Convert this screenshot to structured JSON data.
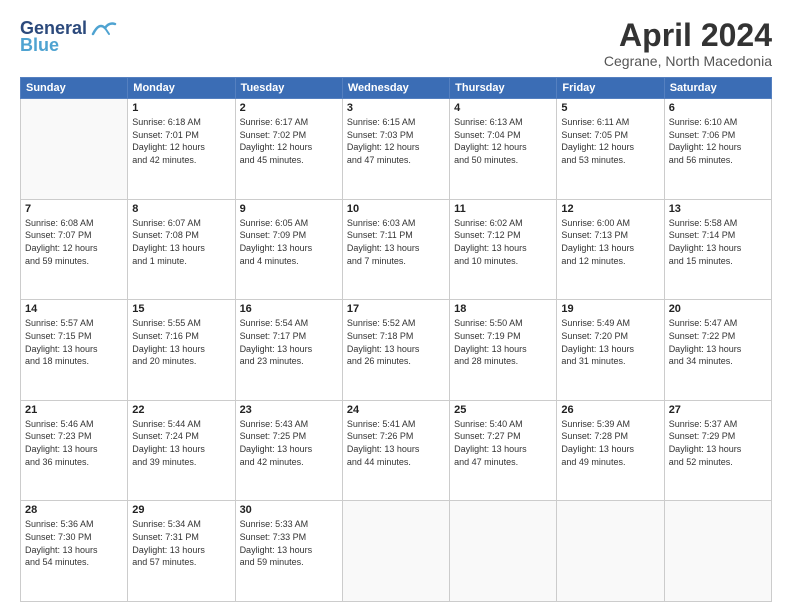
{
  "header": {
    "logo_line1": "General",
    "logo_line2": "Blue",
    "month": "April 2024",
    "location": "Cegrane, North Macedonia"
  },
  "weekdays": [
    "Sunday",
    "Monday",
    "Tuesday",
    "Wednesday",
    "Thursday",
    "Friday",
    "Saturday"
  ],
  "weeks": [
    [
      {
        "day": "",
        "sunrise": "",
        "sunset": "",
        "daylight": ""
      },
      {
        "day": "1",
        "sunrise": "Sunrise: 6:18 AM",
        "sunset": "Sunset: 7:01 PM",
        "daylight": "Daylight: 12 hours and 42 minutes."
      },
      {
        "day": "2",
        "sunrise": "Sunrise: 6:17 AM",
        "sunset": "Sunset: 7:02 PM",
        "daylight": "Daylight: 12 hours and 45 minutes."
      },
      {
        "day": "3",
        "sunrise": "Sunrise: 6:15 AM",
        "sunset": "Sunset: 7:03 PM",
        "daylight": "Daylight: 12 hours and 47 minutes."
      },
      {
        "day": "4",
        "sunrise": "Sunrise: 6:13 AM",
        "sunset": "Sunset: 7:04 PM",
        "daylight": "Daylight: 12 hours and 50 minutes."
      },
      {
        "day": "5",
        "sunrise": "Sunrise: 6:11 AM",
        "sunset": "Sunset: 7:05 PM",
        "daylight": "Daylight: 12 hours and 53 minutes."
      },
      {
        "day": "6",
        "sunrise": "Sunrise: 6:10 AM",
        "sunset": "Sunset: 7:06 PM",
        "daylight": "Daylight: 12 hours and 56 minutes."
      }
    ],
    [
      {
        "day": "7",
        "sunrise": "Sunrise: 6:08 AM",
        "sunset": "Sunset: 7:07 PM",
        "daylight": "Daylight: 12 hours and 59 minutes."
      },
      {
        "day": "8",
        "sunrise": "Sunrise: 6:07 AM",
        "sunset": "Sunset: 7:08 PM",
        "daylight": "Daylight: 13 hours and 1 minute."
      },
      {
        "day": "9",
        "sunrise": "Sunrise: 6:05 AM",
        "sunset": "Sunset: 7:09 PM",
        "daylight": "Daylight: 13 hours and 4 minutes."
      },
      {
        "day": "10",
        "sunrise": "Sunrise: 6:03 AM",
        "sunset": "Sunset: 7:11 PM",
        "daylight": "Daylight: 13 hours and 7 minutes."
      },
      {
        "day": "11",
        "sunrise": "Sunrise: 6:02 AM",
        "sunset": "Sunset: 7:12 PM",
        "daylight": "Daylight: 13 hours and 10 minutes."
      },
      {
        "day": "12",
        "sunrise": "Sunrise: 6:00 AM",
        "sunset": "Sunset: 7:13 PM",
        "daylight": "Daylight: 13 hours and 12 minutes."
      },
      {
        "day": "13",
        "sunrise": "Sunrise: 5:58 AM",
        "sunset": "Sunset: 7:14 PM",
        "daylight": "Daylight: 13 hours and 15 minutes."
      }
    ],
    [
      {
        "day": "14",
        "sunrise": "Sunrise: 5:57 AM",
        "sunset": "Sunset: 7:15 PM",
        "daylight": "Daylight: 13 hours and 18 minutes."
      },
      {
        "day": "15",
        "sunrise": "Sunrise: 5:55 AM",
        "sunset": "Sunset: 7:16 PM",
        "daylight": "Daylight: 13 hours and 20 minutes."
      },
      {
        "day": "16",
        "sunrise": "Sunrise: 5:54 AM",
        "sunset": "Sunset: 7:17 PM",
        "daylight": "Daylight: 13 hours and 23 minutes."
      },
      {
        "day": "17",
        "sunrise": "Sunrise: 5:52 AM",
        "sunset": "Sunset: 7:18 PM",
        "daylight": "Daylight: 13 hours and 26 minutes."
      },
      {
        "day": "18",
        "sunrise": "Sunrise: 5:50 AM",
        "sunset": "Sunset: 7:19 PM",
        "daylight": "Daylight: 13 hours and 28 minutes."
      },
      {
        "day": "19",
        "sunrise": "Sunrise: 5:49 AM",
        "sunset": "Sunset: 7:20 PM",
        "daylight": "Daylight: 13 hours and 31 minutes."
      },
      {
        "day": "20",
        "sunrise": "Sunrise: 5:47 AM",
        "sunset": "Sunset: 7:22 PM",
        "daylight": "Daylight: 13 hours and 34 minutes."
      }
    ],
    [
      {
        "day": "21",
        "sunrise": "Sunrise: 5:46 AM",
        "sunset": "Sunset: 7:23 PM",
        "daylight": "Daylight: 13 hours and 36 minutes."
      },
      {
        "day": "22",
        "sunrise": "Sunrise: 5:44 AM",
        "sunset": "Sunset: 7:24 PM",
        "daylight": "Daylight: 13 hours and 39 minutes."
      },
      {
        "day": "23",
        "sunrise": "Sunrise: 5:43 AM",
        "sunset": "Sunset: 7:25 PM",
        "daylight": "Daylight: 13 hours and 42 minutes."
      },
      {
        "day": "24",
        "sunrise": "Sunrise: 5:41 AM",
        "sunset": "Sunset: 7:26 PM",
        "daylight": "Daylight: 13 hours and 44 minutes."
      },
      {
        "day": "25",
        "sunrise": "Sunrise: 5:40 AM",
        "sunset": "Sunset: 7:27 PM",
        "daylight": "Daylight: 13 hours and 47 minutes."
      },
      {
        "day": "26",
        "sunrise": "Sunrise: 5:39 AM",
        "sunset": "Sunset: 7:28 PM",
        "daylight": "Daylight: 13 hours and 49 minutes."
      },
      {
        "day": "27",
        "sunrise": "Sunrise: 5:37 AM",
        "sunset": "Sunset: 7:29 PM",
        "daylight": "Daylight: 13 hours and 52 minutes."
      }
    ],
    [
      {
        "day": "28",
        "sunrise": "Sunrise: 5:36 AM",
        "sunset": "Sunset: 7:30 PM",
        "daylight": "Daylight: 13 hours and 54 minutes."
      },
      {
        "day": "29",
        "sunrise": "Sunrise: 5:34 AM",
        "sunset": "Sunset: 7:31 PM",
        "daylight": "Daylight: 13 hours and 57 minutes."
      },
      {
        "day": "30",
        "sunrise": "Sunrise: 5:33 AM",
        "sunset": "Sunset: 7:33 PM",
        "daylight": "Daylight: 13 hours and 59 minutes."
      },
      {
        "day": "",
        "sunrise": "",
        "sunset": "",
        "daylight": ""
      },
      {
        "day": "",
        "sunrise": "",
        "sunset": "",
        "daylight": ""
      },
      {
        "day": "",
        "sunrise": "",
        "sunset": "",
        "daylight": ""
      },
      {
        "day": "",
        "sunrise": "",
        "sunset": "",
        "daylight": ""
      }
    ]
  ]
}
